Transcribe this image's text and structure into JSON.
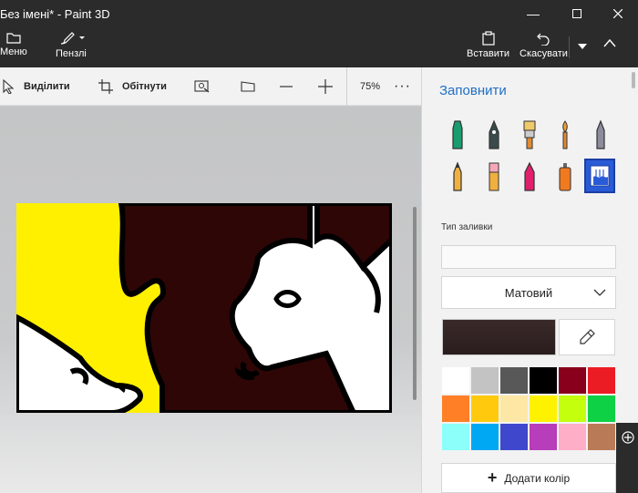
{
  "window": {
    "title": "Без імені* - Paint 3D",
    "minimize_icon": "minimize-icon",
    "maximize_icon": "maximize-icon",
    "close_icon": "close-icon"
  },
  "ribbon": {
    "menu_label": "Меню",
    "brushes_label": "Пензлі",
    "paste_label": "Вставити",
    "undo_label": "Скасувати"
  },
  "toolbar": {
    "select_label": "Виділити",
    "crop_label": "Обітнути",
    "zoom_value": "75%"
  },
  "panel": {
    "title": "Заповнити",
    "fill_type_label": "Тип заливки",
    "fill_type_value": "",
    "finish_value": "Матовий",
    "add_color_label": "Додати колір",
    "current_color": "#2e2020"
  },
  "palette": [
    "#ffffff",
    "#c3c3c3",
    "#585858",
    "#000000",
    "#88001b",
    "#ec1c24",
    "#ff7f27",
    "#ffc90e",
    "#fde7a5",
    "#fff200",
    "#c4ff0e",
    "#0ed145",
    "#8cfffb",
    "#00a8f3",
    "#3f48cc",
    "#b83dba",
    "#ffaec8",
    "#b97a57"
  ],
  "brushes": [
    "marker",
    "calligraphy-pen",
    "oil-brush",
    "watercolor",
    "pencil",
    "crayon",
    "eraser",
    "crayon-red",
    "spray-can",
    "fill-bucket"
  ]
}
